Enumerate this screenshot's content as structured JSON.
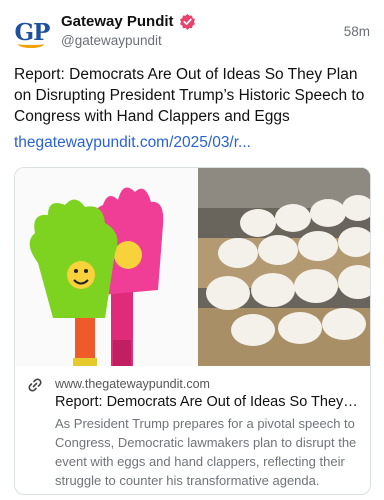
{
  "author": {
    "display_name": "Gateway Pundit",
    "handle": "@gatewaypundit",
    "avatar_text": "GP",
    "verified_icon": "verified-badge-icon"
  },
  "post": {
    "time_ago": "58m",
    "text": "Report: Democrats Are Out of Ideas So They Plan on Disrupting President Trump’s Historic Speech to Congress with Hand Clappers and Eggs",
    "link_text": "thegatewaypundit.com/2025/03/r..."
  },
  "link_card": {
    "link_icon": "link-icon",
    "domain": "www.thegatewaypundit.com",
    "title": "Report: Democrats Are Out of Ideas So They Pl...",
    "description": "As President Trump prepares for a pivotal speech to Congress, Democratic lawmakers plan to disrupt the event with eggs and hand clappers, reflecting their struggle to counter his transformative agenda."
  },
  "colors": {
    "link": "#2a62cf",
    "verified": "#e8436e",
    "avatar_blue": "#1e4fa0",
    "avatar_orange": "#f2a200"
  }
}
